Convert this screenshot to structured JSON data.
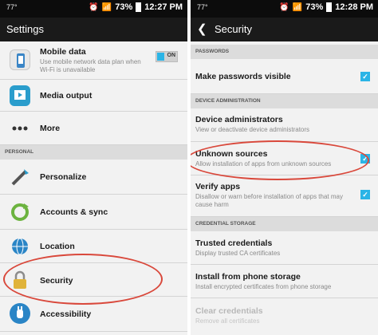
{
  "left": {
    "status": {
      "temp": "77°",
      "battery": "73%",
      "time": "12:27 PM"
    },
    "title": "Settings",
    "items_top": [
      {
        "label": "Mobile data",
        "sub": "Use mobile network data plan when Wi-Fi is unavailable",
        "toggle": "ON"
      },
      {
        "label": "Media output"
      },
      {
        "label": "More"
      }
    ],
    "section_personal": "PERSONAL",
    "items_personal": [
      {
        "label": "Personalize"
      },
      {
        "label": "Accounts & sync"
      },
      {
        "label": "Location"
      },
      {
        "label": "Security"
      },
      {
        "label": "Accessibility"
      }
    ]
  },
  "right": {
    "status": {
      "temp": "77°",
      "battery": "73%",
      "time": "12:28 PM"
    },
    "title": "Security",
    "sections": {
      "passwords": "PASSWORDS",
      "device_admin": "DEVICE ADMINISTRATION",
      "credential_storage": "CREDENTIAL STORAGE"
    },
    "make_passwords_visible": {
      "label": "Make passwords visible",
      "checked": true
    },
    "device_administrators": {
      "label": "Device administrators",
      "sub": "View or deactivate device administrators"
    },
    "unknown_sources": {
      "label": "Unknown sources",
      "sub": "Allow installation of apps from unknown sources",
      "checked": true
    },
    "verify_apps": {
      "label": "Verify apps",
      "sub": "Disallow or warn before installation of apps that may cause harm",
      "checked": true
    },
    "trusted_credentials": {
      "label": "Trusted credentials",
      "sub": "Display trusted CA certificates"
    },
    "install_from_storage": {
      "label": "Install from phone storage",
      "sub": "Install encrypted certificates from phone storage"
    },
    "clear_credentials": {
      "label": "Clear credentials",
      "sub": "Remove all certificates"
    }
  },
  "colors": {
    "accent": "#2bb4e6",
    "highlight": "#d9483b"
  }
}
